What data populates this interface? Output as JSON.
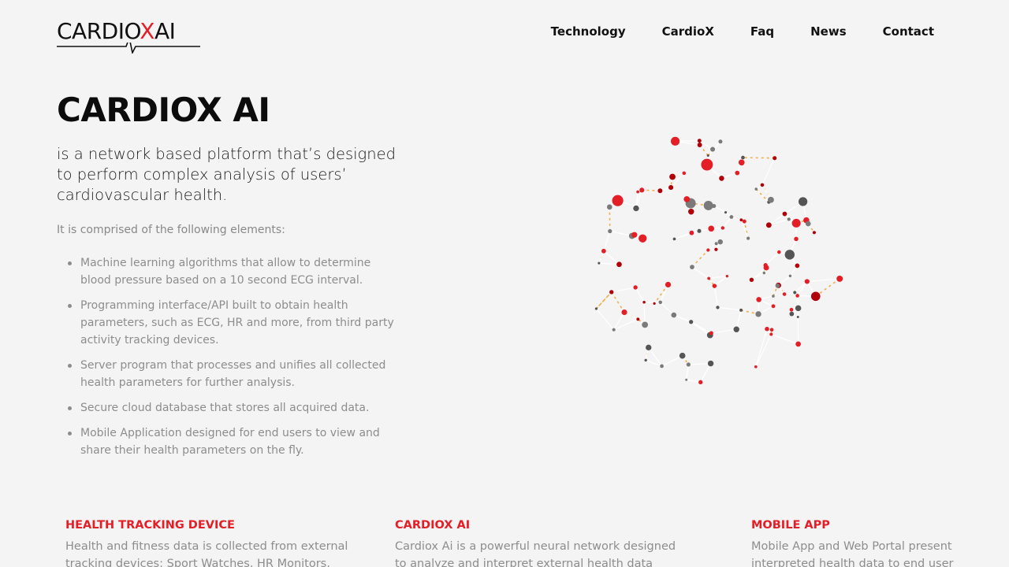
{
  "brand": {
    "logo_prefix": "CARD",
    "logo_i": "I",
    "logo_o": "O",
    "logo_x": "X",
    "logo_suffix": "AI",
    "accent": "#e41e26"
  },
  "nav": {
    "items": [
      {
        "label": "Technology"
      },
      {
        "label": "CardioX"
      },
      {
        "label": "Faq"
      },
      {
        "label": "News"
      },
      {
        "label": "Contact"
      }
    ]
  },
  "hero": {
    "title": "CARDIOX AI",
    "lead": "is a network based platform that’s designed to perform complex analysis of users’ cardiovascular health.",
    "intro": "It is comprised of the following elements:",
    "elements": [
      "Machine learning algorithms that allow to determine blood pressure based on a 10 second ECG interval.",
      "Programming interface/API built to obtain health parameters, such as ECG, HR and more, from third party activity tracking devices.",
      "Server program that processes and unifies all collected health parameters for further analysis.",
      "Secure cloud database that stores all acquired data.",
      "Mobile Application designed for end users to view and share their health parameters on the fly."
    ]
  },
  "features": [
    {
      "title": "HEALTH TRACKING DEVICE",
      "text": "Health and fitness data is collected from external tracking devices: Sport Watches, HR Monitors,"
    },
    {
      "title": "CARDIOX AI",
      "text": "Cardiox Ai is a powerful neural network designed to analyze and interpret external health data"
    },
    {
      "title": "MOBILE APP",
      "text": "Mobile App and Web Portal present interpreted health data to end user"
    }
  ],
  "network_colors": {
    "red": "#e41e26",
    "dark_red": "#b0000a",
    "grey": "#7a7a7a",
    "dark_grey": "#555555",
    "link": "#ffffff",
    "highlight": "#f0b050"
  }
}
